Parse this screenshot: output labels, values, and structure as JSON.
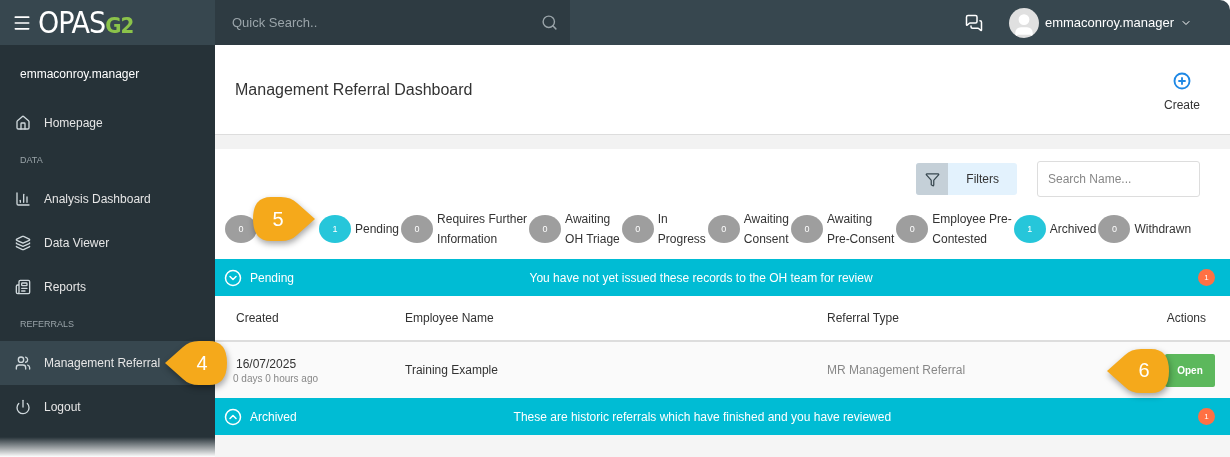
{
  "app": {
    "logo_main": "OPAS",
    "logo_accent": "G2"
  },
  "search": {
    "placeholder": "Quick Search.."
  },
  "user": {
    "name": "emmaconroy.manager"
  },
  "sidebar": {
    "user": "emmaconroy.manager",
    "items": [
      {
        "kind": "link",
        "label": "Homepage",
        "selected": false
      },
      {
        "kind": "section",
        "label": "DATA"
      },
      {
        "kind": "link",
        "label": "Analysis Dashboard",
        "selected": false
      },
      {
        "kind": "link",
        "label": "Data Viewer",
        "selected": false
      },
      {
        "kind": "link",
        "label": "Reports",
        "selected": false
      },
      {
        "kind": "section",
        "label": "REFERRALS"
      },
      {
        "kind": "link",
        "label": "Management Referral",
        "selected": true,
        "callout": "4"
      },
      {
        "kind": "link",
        "label": "Logout",
        "selected": false
      }
    ]
  },
  "page": {
    "title": "Management Referral Dashboard",
    "create": "Create"
  },
  "filters": {
    "button": "Filters",
    "search_placeholder": "Search Name..."
  },
  "statuses": [
    {
      "count": "0",
      "color": "#9e9e9e"
    },
    {
      "count": "1",
      "lines": [
        "Pending"
      ],
      "color": "#26c6da",
      "callout": "5"
    },
    {
      "count": "0",
      "lines": [
        "Requires Further",
        "Information"
      ],
      "color": "#9e9e9e"
    },
    {
      "count": "0",
      "lines": [
        "Awaiting",
        "OH Triage"
      ],
      "color": "#9e9e9e"
    },
    {
      "count": "0",
      "lines": [
        "In",
        "Progress"
      ],
      "color": "#9e9e9e"
    },
    {
      "count": "0",
      "lines": [
        "Awaiting",
        "Consent"
      ],
      "color": "#9e9e9e"
    },
    {
      "count": "0",
      "lines": [
        "Awaiting",
        "Pre-Consent"
      ],
      "color": "#9e9e9e"
    },
    {
      "count": "0",
      "lines": [
        "Employee Pre-",
        "Contested"
      ],
      "color": "#9e9e9e"
    },
    {
      "count": "1",
      "lines": [
        "Archived"
      ],
      "color": "#26c6da"
    },
    {
      "count": "0",
      "lines": [
        "Withdrawn"
      ],
      "color": "#9e9e9e"
    }
  ],
  "sections": [
    {
      "title": "Pending",
      "message": "You have not yet issued these records to the OH team for review",
      "count": "1",
      "expanded": true,
      "columns": [
        "Created",
        "Employee Name",
        "Referral Type",
        "Actions"
      ],
      "rows": [
        {
          "created": "16/07/2025",
          "age": "0 days 0 hours ago",
          "employee": "Training Example",
          "type": "MR Management Referral",
          "action": "Open",
          "callout": "6"
        }
      ]
    },
    {
      "title": "Archived",
      "message": "These are historic referrals which have finished and you have reviewed",
      "count": "1",
      "expanded": false
    }
  ]
}
